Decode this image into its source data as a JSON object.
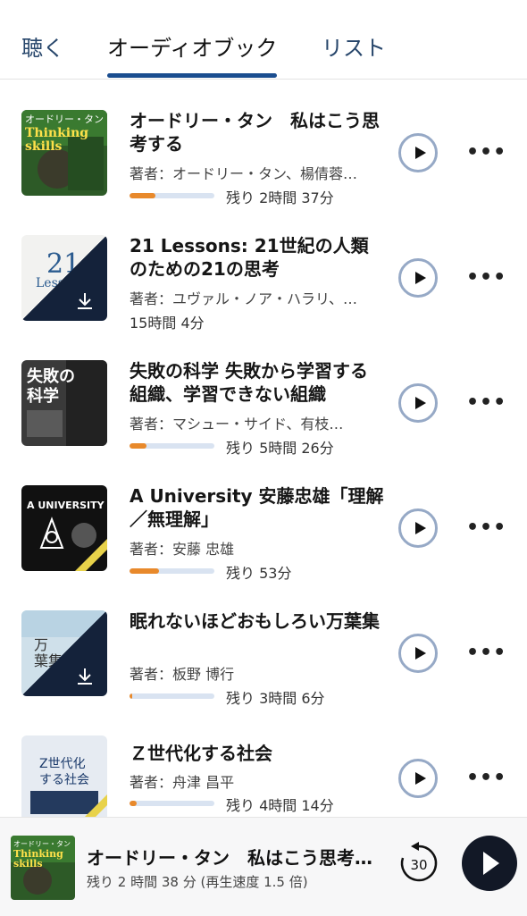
{
  "tabs": [
    {
      "label": "聴く"
    },
    {
      "label": "オーディオブック"
    },
    {
      "label": "リスト"
    }
  ],
  "books": [
    {
      "title": "オードリー・タン　私はこう思考する",
      "author": "著者：オードリー・タン、楊倩蓉…",
      "remaining": "残り 2時間 37分",
      "progress": 0.3,
      "downloaded": true
    },
    {
      "title": "21 Lessons: 21世紀の人類のための21の思考",
      "author": "著者：ユヴァル・ノア・ハラリ、…",
      "remaining": "15時間 4分",
      "progress": null,
      "downloaded": false
    },
    {
      "title": "失敗の科学 失敗から学習する組織、学習できない組織",
      "author": "著者：マシュー・サイド、有枝…",
      "remaining": "残り 5時間 26分",
      "progress": 0.2,
      "downloaded": true
    },
    {
      "title": "A University 安藤忠雄「理解／無理解」",
      "author": "著者：安藤 忠雄",
      "remaining": "残り 53分",
      "progress": 0.35,
      "downloaded": true
    },
    {
      "title": "眠れないほどおもしろい万葉集",
      "author": "著者：板野 博行",
      "remaining": "残り 3時間 6分",
      "progress": 0.03,
      "downloaded": false
    },
    {
      "title": "Ｚ世代化する社会",
      "author": "著者：舟津 昌平",
      "remaining": "残り 4時間 14分",
      "progress": 0.08,
      "downloaded": true
    }
  ],
  "mini_player": {
    "title": "オードリー・タン　私はこう思考する",
    "subtitle": "残り 2 時間 38 分 (再生速度 1.5 倍)",
    "rewind_seconds": "30"
  },
  "icons": {
    "play": "play-icon",
    "more": "more-icon",
    "download": "download-icon",
    "rewind": "rewind-30-icon"
  },
  "colors": {
    "progress_fill": "#e8892b",
    "progress_track": "#d9e3f1",
    "tab_underline": "#1a4d8f",
    "play_border": "#96a9c6",
    "big_play_bg": "#121826"
  },
  "more_glyph": "•••"
}
